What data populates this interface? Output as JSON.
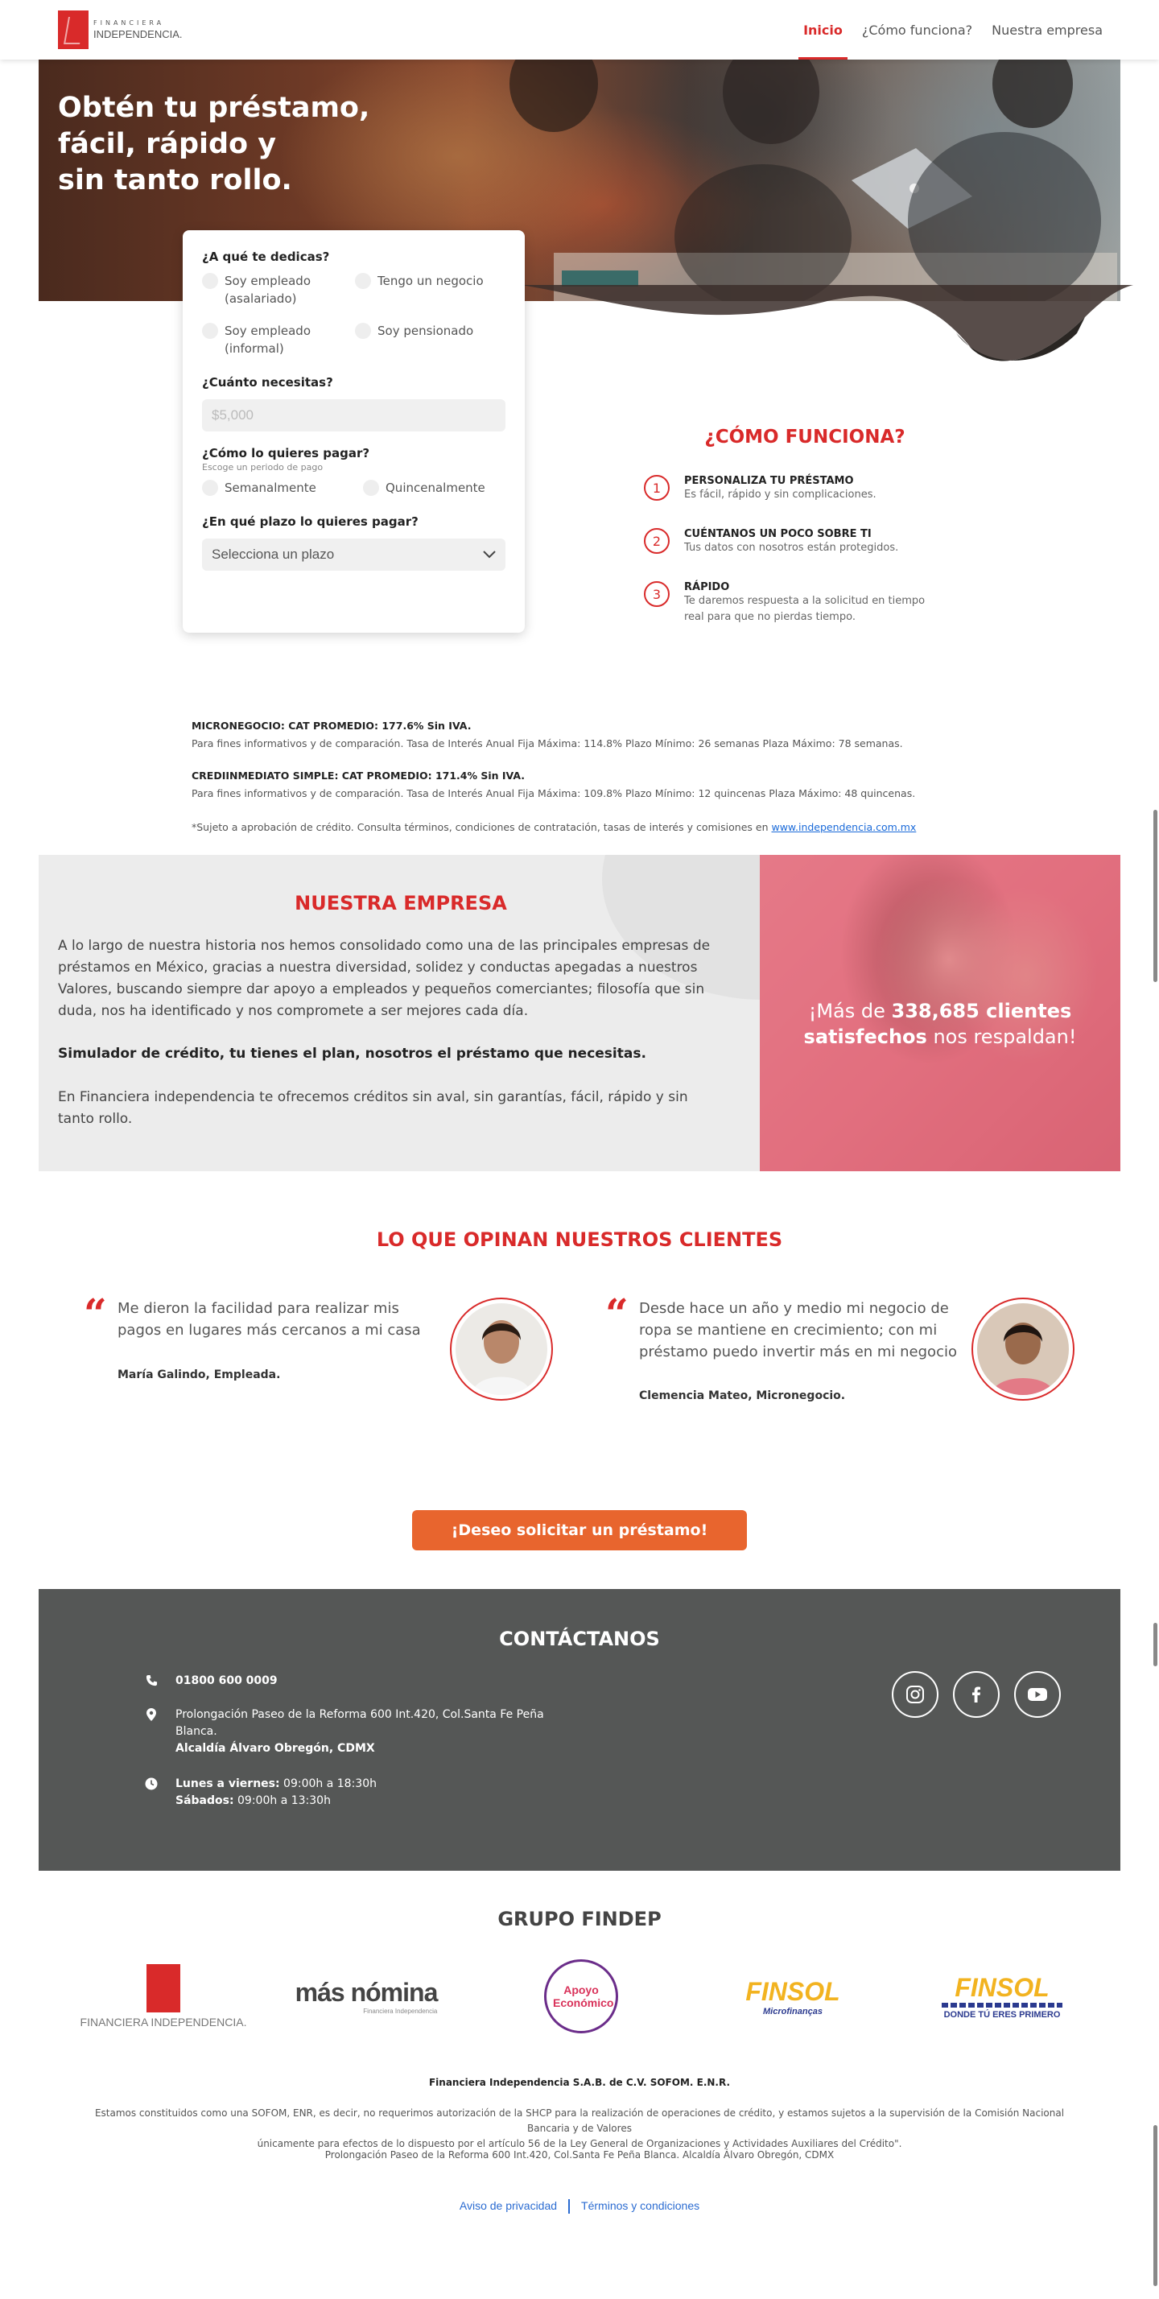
{
  "header": {
    "logo_top": "FINANCIERA",
    "logo_bottom": "INDEPENDENCIA.",
    "nav": [
      {
        "label": "Inicio",
        "active": true
      },
      {
        "label": "¿Cómo funciona?",
        "active": false
      },
      {
        "label": "Nuestra empresa",
        "active": false
      }
    ]
  },
  "hero": {
    "title_lines": [
      "Obtén tu préstamo,",
      "fácil, rápido y",
      "sin tanto rollo."
    ]
  },
  "form": {
    "q1": "¿A qué te dedicas?",
    "q1_options": [
      "Soy empleado (asalariado)",
      "Tengo un negocio",
      "Soy empleado (informal)",
      "Soy pensionado"
    ],
    "q2": "¿Cuánto necesitas?",
    "q2_placeholder": "$5,000",
    "q3": "¿Cómo lo quieres pagar?",
    "q3_sub": "Escoge un periodo de pago",
    "q3_options": [
      "Semanalmente",
      "Quincenalmente"
    ],
    "q4": "¿En qué plazo lo quieres pagar?",
    "q4_select": "Selecciona un plazo"
  },
  "como_funciona": {
    "title": "¿CÓMO FUNCIONA?",
    "steps": [
      {
        "num": "1",
        "title": "PERSONALIZA TU PRÉSTAMO",
        "desc": "Es fácil, rápido y sin complicaciones."
      },
      {
        "num": "2",
        "title": "CUÉNTANOS UN POCO SOBRE TI",
        "desc": "Tus datos con nosotros están protegidos."
      },
      {
        "num": "3",
        "title": "RÁPIDO",
        "desc": "Te daremos respuesta a la solicitud en tiempo real para que no pierdas tiempo."
      }
    ]
  },
  "disclaimers": {
    "d1_title": "MICRONEGOCIO: CAT PROMEDIO: 177.6% Sin IVA.",
    "d1_text": "Para fines informativos y de comparación. Tasa de Interés Anual Fija Máxima: 114.8% Plazo Mínimo: 26 semanas Plaza Máximo: 78 semanas.",
    "d2_title": "CREDIINMEDIATO SIMPLE: CAT PROMEDIO: 171.4% Sin IVA.",
    "d2_text": "Para fines informativos y de comparación. Tasa de Interés Anual Fija Máxima: 109.8% Plazo Mínimo: 12 quincenas Plaza Máximo: 48 quincenas.",
    "d3_text": "*Sujeto a aprobación de crédito. Consulta términos, condiciones de contratación, tasas de interés y comisiones en",
    "d3_link": "www.independencia.com.mx"
  },
  "empresa": {
    "title": "NUESTRA EMPRESA",
    "p1": "A lo largo de nuestra historia nos hemos consolidado como una de las principales empresas de préstamos en México, gracias a nuestra diversidad, solidez y conductas apegadas a nuestros Valores, buscando siempre dar apoyo a empleados y pequeños comerciantes; filosofía que sin duda, nos ha identificado y nos compromete a ser mejores cada día.",
    "p2": "Simulador de crédito, tu tienes el plan, nosotros el préstamo que necesitas.",
    "p3": "En Financiera independencia te ofrecemos créditos sin aval, sin garantías, fácil, rápido y sin tanto rollo.",
    "photo_pre": "¡Más de ",
    "photo_bold": "338,685 clientes satisfechos",
    "photo_post": " nos respaldan!"
  },
  "opiniones": {
    "title": "LO QUE OPINAN NUESTROS CLIENTES",
    "items": [
      {
        "text": "Me dieron la facilidad para realizar mis pagos en lugares más cercanos a mi casa",
        "author": "María Galindo, Empleada."
      },
      {
        "text": "Desde hace un año y medio mi negocio de ropa se mantiene en crecimiento; con mi préstamo puedo invertir más en mi negocio",
        "author": "Clemencia Mateo, Micronegocio."
      }
    ]
  },
  "cta": {
    "label": "¡Deseo solicitar un préstamo!"
  },
  "contacto": {
    "title": "CONTÁCTANOS",
    "phone": "01800 600 0009",
    "address_l1": "Prolongación Paseo de la Reforma 600 Int.420, Col.Santa Fe Peña",
    "address_l2": "Blanca.",
    "address_l3": "Alcaldía Álvaro Obregón, CDMX",
    "hours_l1_b": "Lunes a viernes:",
    "hours_l1": " 09:00h a 18:30h",
    "hours_l2_b": "Sábados:",
    "hours_l2": " 09:00h a 13:30h",
    "socials": [
      "instagram-icon",
      "facebook-icon",
      "youtube-icon"
    ]
  },
  "grupo": {
    "title": "GRUPO FINDEP",
    "brands": [
      "FINANCIERA INDEPENDENCIA.",
      "más nómina",
      "Apoyo Económico",
      "FINSOL Microfinanças",
      "FINSOL DONDE TÚ ERES PRIMERO"
    ],
    "masnomina_sub": "Financiera Independencia",
    "finsol_sub1": "Microfinanças",
    "finsol_sub2": "DONDE TÚ ERES PRIMERO"
  },
  "footer": {
    "company": "Financiera Independencia S.A.B. de C.V. SOFOM. E.N.R.",
    "legal1": "Estamos constituidos como una SOFOM, ENR, es decir, no requerimos autorización de la SHCP para la realización de operaciones de crédito, y estamos sujetos a la supervisión de la Comisión Nacional Bancaria y de Valores",
    "legal2": "únicamente para efectos de lo dispuesto por el artículo 56 de la Ley General de Organizaciones y Actividades Auxiliares del Crédito\".",
    "address": "Prolongación Paseo de la Reforma 600 Int.420, Col.Santa Fe Peña Blanca. Alcaldía Álvaro Obregón, CDMX",
    "link1": "Aviso de privacidad",
    "link2": "Términos y condiciones"
  },
  "colors": {
    "accent": "#d92a2a",
    "cta": "#e8652e",
    "contact_bg": "#555756",
    "link": "#2a6bd1"
  }
}
